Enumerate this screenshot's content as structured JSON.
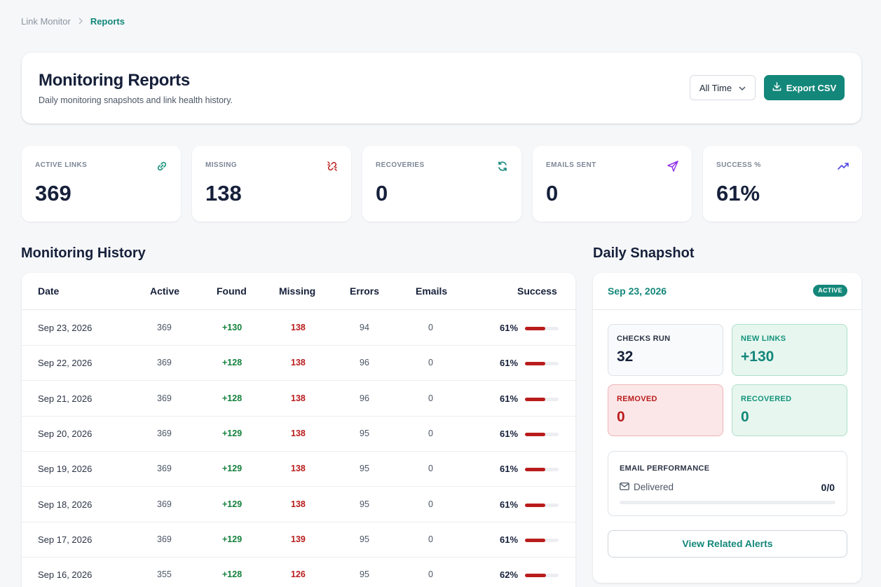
{
  "breadcrumb": {
    "parent": "Link Monitor",
    "current": "Reports"
  },
  "header": {
    "title": "Monitoring Reports",
    "subtitle": "Daily monitoring snapshots and link health history.",
    "range_value": "All Time",
    "export_label": "Export CSV"
  },
  "stats": [
    {
      "label": "ACTIVE LINKS",
      "value": "369",
      "icon": "link-icon",
      "color": "#13937b"
    },
    {
      "label": "MISSING",
      "value": "138",
      "icon": "broken-link-icon",
      "color": "#b91c1c"
    },
    {
      "label": "RECOVERIES",
      "value": "0",
      "icon": "refresh-icon",
      "color": "#13877a"
    },
    {
      "label": "EMAILS SENT",
      "value": "0",
      "icon": "send-icon",
      "color": "#9333ea"
    },
    {
      "label": "SUCCESS %",
      "value": "61%",
      "icon": "trending-up-icon",
      "color": "#4f46e5"
    }
  ],
  "history": {
    "title": "Monitoring History",
    "columns": [
      "Date",
      "Active",
      "Found",
      "Missing",
      "Errors",
      "Emails",
      "Success"
    ],
    "rows": [
      {
        "date": "Sep 23, 2026",
        "active": "369",
        "found": "+130",
        "missing": "138",
        "errors": "94",
        "emails": "0",
        "success": "61%",
        "success_fraction": 0.61
      },
      {
        "date": "Sep 22, 2026",
        "active": "369",
        "found": "+128",
        "missing": "138",
        "errors": "96",
        "emails": "0",
        "success": "61%",
        "success_fraction": 0.61
      },
      {
        "date": "Sep 21, 2026",
        "active": "369",
        "found": "+128",
        "missing": "138",
        "errors": "96",
        "emails": "0",
        "success": "61%",
        "success_fraction": 0.61
      },
      {
        "date": "Sep 20, 2026",
        "active": "369",
        "found": "+129",
        "missing": "138",
        "errors": "95",
        "emails": "0",
        "success": "61%",
        "success_fraction": 0.61
      },
      {
        "date": "Sep 19, 2026",
        "active": "369",
        "found": "+129",
        "missing": "138",
        "errors": "95",
        "emails": "0",
        "success": "61%",
        "success_fraction": 0.61
      },
      {
        "date": "Sep 18, 2026",
        "active": "369",
        "found": "+129",
        "missing": "138",
        "errors": "95",
        "emails": "0",
        "success": "61%",
        "success_fraction": 0.61
      },
      {
        "date": "Sep 17, 2026",
        "active": "369",
        "found": "+129",
        "missing": "139",
        "errors": "95",
        "emails": "0",
        "success": "61%",
        "success_fraction": 0.61
      },
      {
        "date": "Sep 16, 2026",
        "active": "355",
        "found": "+128",
        "missing": "126",
        "errors": "95",
        "emails": "0",
        "success": "62%",
        "success_fraction": 0.62
      }
    ]
  },
  "snapshot": {
    "title": "Daily Snapshot",
    "date": "Sep 23, 2026",
    "badge": "ACTIVE",
    "tiles": {
      "checks_run": {
        "label": "CHECKS RUN",
        "value": "32"
      },
      "new_links": {
        "label": "NEW LINKS",
        "value": "+130"
      },
      "removed": {
        "label": "REMOVED",
        "value": "0"
      },
      "recovered": {
        "label": "RECOVERED",
        "value": "0"
      }
    },
    "email": {
      "title": "EMAIL PERFORMANCE",
      "delivered_label": "Delivered",
      "count": "0/0",
      "delivered_fraction": 0
    },
    "alerts_button": "View Related Alerts"
  },
  "colors": {
    "accent": "#13877a",
    "danger": "#b91c1c",
    "success": "#15803d"
  }
}
